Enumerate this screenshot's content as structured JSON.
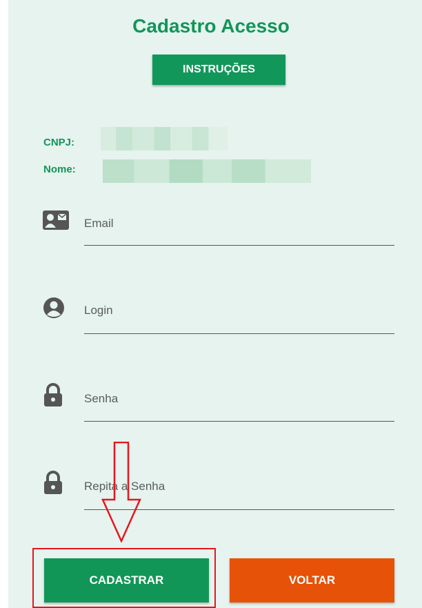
{
  "header": {
    "title": "Cadastro Acesso",
    "instructions_label": "INSTRUÇÕES"
  },
  "info": {
    "cnpj_label": "CNPJ:",
    "nome_label": "Nome:"
  },
  "fields": [
    {
      "icon": "contact-card-icon",
      "label": "Email"
    },
    {
      "icon": "user-circle-icon",
      "label": "Login"
    },
    {
      "icon": "lock-icon",
      "label": "Senha"
    },
    {
      "icon": "lock-icon",
      "label": "Repita a Senha"
    }
  ],
  "actions": {
    "submit_label": "CADASTRAR",
    "back_label": "VOLTAR"
  },
  "colors": {
    "accent": "#13945a",
    "submit": "#129658",
    "back": "#e65208",
    "panel": "#e6f3ee",
    "annotation": "#e8141c"
  }
}
